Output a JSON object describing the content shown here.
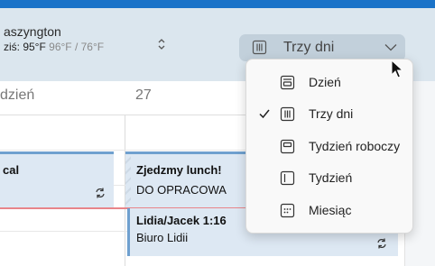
{
  "weather": {
    "city": "aszyngton",
    "today_prefix": "ziś: 95°F",
    "temps": " 96°F / 76°F"
  },
  "view_button": {
    "label": "Trzy dni"
  },
  "day_headers": {
    "left": "dzień",
    "right": "27"
  },
  "events": [
    {
      "title": "cal",
      "subtitle": ""
    },
    {
      "title": "Zjedzmy lunch!",
      "subtitle": "DO OPRACOWA"
    },
    {
      "title": "Lidia/Jacek 1:16",
      "subtitle": "Biuro Lidii"
    }
  ],
  "menu": {
    "items": [
      {
        "label": "Dzień",
        "icon": "day-view-icon",
        "checked": false
      },
      {
        "label": "Trzy dni",
        "icon": "three-day-view-icon",
        "checked": true
      },
      {
        "label": "Tydzień roboczy",
        "icon": "work-week-view-icon",
        "checked": false
      },
      {
        "label": "Tydzień",
        "icon": "week-view-icon",
        "checked": false
      },
      {
        "label": "Miesiąc",
        "icon": "month-view-icon",
        "checked": false
      }
    ]
  },
  "colors": {
    "accent": "#1a73c8",
    "weather_bg": "#dbe6ee",
    "event_bg": "#dde8f3",
    "event_border": "#6fa0cf",
    "now_line": "#e8858a"
  }
}
